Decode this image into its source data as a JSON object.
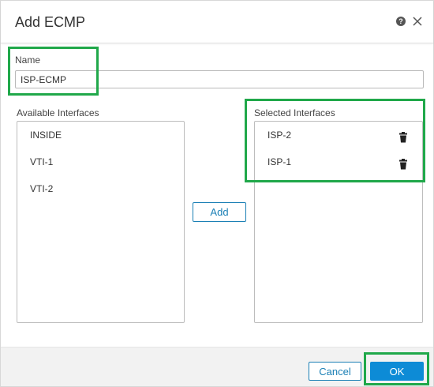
{
  "dialog": {
    "title": "Add ECMP",
    "help_icon_glyph": "?",
    "help_icon": "help-icon",
    "close_icon": "close-icon"
  },
  "form": {
    "name_label": "Name",
    "name_value": "ISP-ECMP"
  },
  "available": {
    "label": "Available Interfaces",
    "items": [
      "INSIDE",
      "VTI-1",
      "VTI-2"
    ]
  },
  "selected": {
    "label": "Selected Interfaces",
    "items": [
      "ISP-2",
      "ISP-1"
    ],
    "item_icon": "trash-icon"
  },
  "actions": {
    "add_label": "Add",
    "cancel_label": "Cancel",
    "ok_label": "OK"
  },
  "colors": {
    "accent": "#0d8bd6",
    "link": "#1a7fb5",
    "highlight": "#20a84a"
  }
}
